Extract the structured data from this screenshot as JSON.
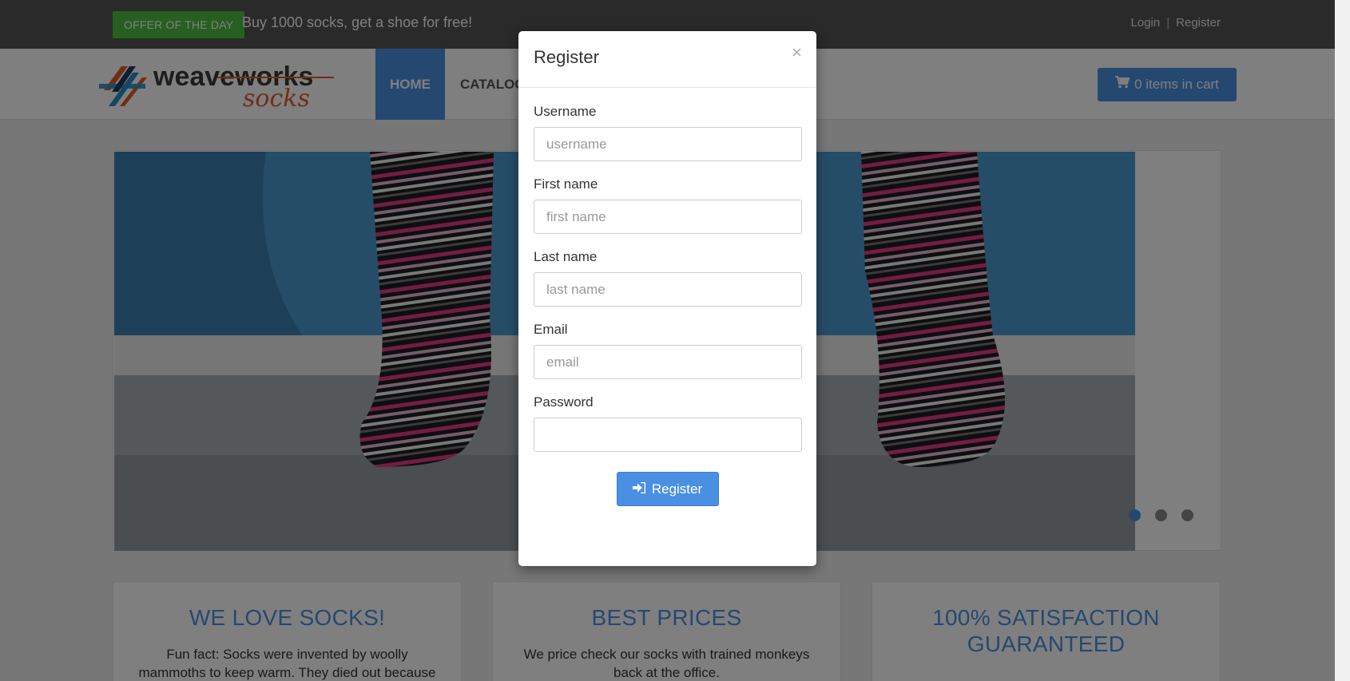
{
  "topbar": {
    "offer_badge": "OFFER OF THE DAY",
    "offer_text": "Buy 1000 socks, get a shoe for free!",
    "login": "Login",
    "separator": "|",
    "register": "Register"
  },
  "navbar": {
    "logo_text_1": "weaveworks",
    "logo_text_2": "socks",
    "home": "HOME",
    "catalogue": "CATALOG",
    "cart": "0 items in cart"
  },
  "carousel": {
    "slides": 3,
    "active_slide": 1
  },
  "features": [
    {
      "title": "WE LOVE SOCKS!",
      "text": "Fun fact: Socks were invented by woolly mammoths to keep warm. They died out because"
    },
    {
      "title": "BEST PRICES",
      "text": "We price check our socks with trained monkeys back at the office."
    },
    {
      "title": "100% SATISFACTION GUARANTEED",
      "text": ""
    }
  ],
  "modal": {
    "title": "Register",
    "close": "×",
    "fields": [
      {
        "label": "Username",
        "placeholder": "username",
        "value": ""
      },
      {
        "label": "First name",
        "placeholder": "first name",
        "value": ""
      },
      {
        "label": "Last name",
        "placeholder": "last name",
        "value": ""
      },
      {
        "label": "Email",
        "placeholder": "email",
        "value": ""
      },
      {
        "label": "Password",
        "placeholder": "",
        "value": ""
      }
    ],
    "submit": "Register"
  },
  "colors": {
    "accent": "#4a90e2",
    "offer_green": "#4fbf40",
    "topbar": "#555555"
  }
}
